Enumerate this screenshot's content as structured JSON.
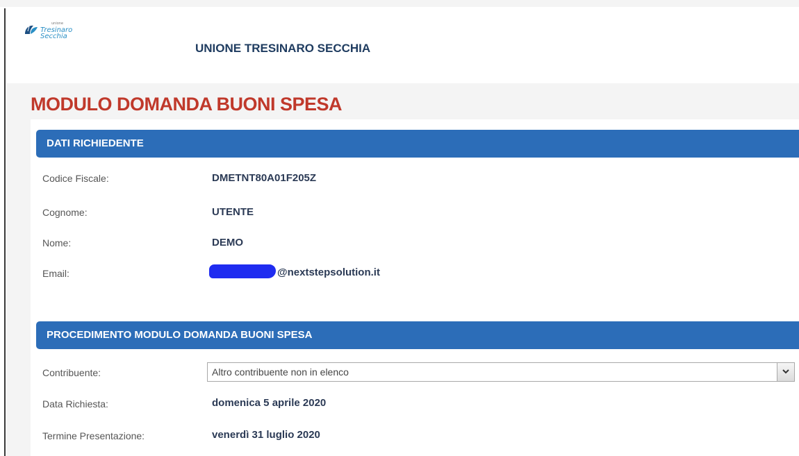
{
  "header": {
    "logo": {
      "line1": "unione",
      "line2": "Tresinaro",
      "line3": "Secchia"
    },
    "org_name": "UNIONE TRESINARO SECCHIA"
  },
  "page": {
    "title": "MODULO DOMANDA BUONI SPESA"
  },
  "section_applicant": {
    "title": "DATI RICHIEDENTE",
    "fields": [
      {
        "label": "Codice Fiscale:",
        "value": "DMETNT80A01F205Z"
      },
      {
        "label": "Cognome:",
        "value": "UTENTE"
      },
      {
        "label": "Nome:",
        "value": "DEMO"
      },
      {
        "label": "Email:",
        "value": "@nextstepsolution.it"
      }
    ]
  },
  "section_procedure": {
    "title": "PROCEDIMENTO MODULO DOMANDA BUONI SPESA",
    "contribuente_label": "Contribuente:",
    "contribuente_selected": "Altro contribuente non in elenco",
    "data_richiesta_label": "Data Richiesta:",
    "data_richiesta_value": "domenica 5 aprile 2020",
    "termine_label": "Termine Presentazione:",
    "termine_value": "venerdì 31 luglio 2020"
  },
  "colors": {
    "title_red": "#c0392b",
    "section_blue": "#2c6db8",
    "org_navy": "#1f3c60",
    "redaction_blue": "#1f2cf0"
  },
  "icons": [
    "logo-leaf-icon",
    "chevron-down-icon"
  ]
}
